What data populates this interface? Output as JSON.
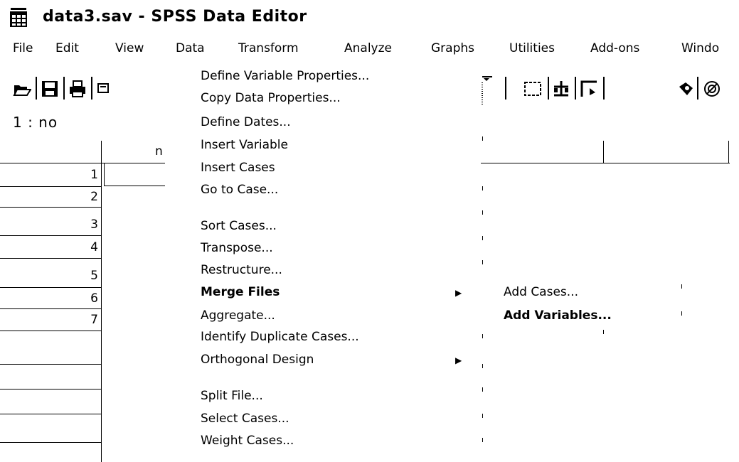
{
  "window": {
    "title": "data3.sav - SPSS Data Editor",
    "app_icon": "spss-icon"
  },
  "menubar": [
    "File",
    "Edit",
    "View",
    "Data",
    "Transform",
    "Analyze",
    "Graphs",
    "Utilities",
    "Add-ons",
    "Windo"
  ],
  "toolbar": {
    "left_icons": [
      "open-folder-icon",
      "save-disk-icon",
      "print-icon",
      "dialog-recall-icon"
    ],
    "right_icons": [
      "variables-icon",
      "split-file-icon",
      "weight-cases-icon",
      "select-cases-icon",
      "value-labels-icon",
      "use-sets-icon"
    ]
  },
  "cell_ref": "1 : no",
  "grid": {
    "column_header": "n",
    "rows": [
      "1",
      "2",
      "3",
      "4",
      "5",
      "6",
      "7",
      "",
      "",
      "",
      "",
      ""
    ]
  },
  "data_menu": {
    "items": [
      {
        "label": "Define Variable Properties...",
        "bold": false,
        "submenu": false
      },
      {
        "label": "Copy Data Properties...",
        "bold": false,
        "submenu": false
      },
      {
        "label": "Define Dates...",
        "bold": false,
        "submenu": false
      },
      {
        "label": "Insert Variable",
        "bold": false,
        "submenu": false
      },
      {
        "label": "Insert Cases",
        "bold": false,
        "submenu": false
      },
      {
        "label": "Go to Case...",
        "bold": false,
        "submenu": false
      },
      {
        "label": "Sort Cases...",
        "bold": false,
        "submenu": false
      },
      {
        "label": "Transpose...",
        "bold": false,
        "submenu": false
      },
      {
        "label": "Restructure...",
        "bold": false,
        "submenu": false
      },
      {
        "label": "Merge Files",
        "bold": true,
        "submenu": true
      },
      {
        "label": "Aggregate...",
        "bold": false,
        "submenu": false
      },
      {
        "label": "Identify Duplicate Cases...",
        "bold": false,
        "submenu": false
      },
      {
        "label": "Orthogonal Design",
        "bold": false,
        "submenu": true
      },
      {
        "label": "Split File...",
        "bold": false,
        "submenu": false
      },
      {
        "label": "Select Cases...",
        "bold": false,
        "submenu": false
      },
      {
        "label": "Weight Cases...",
        "bold": false,
        "submenu": false
      }
    ]
  },
  "merge_submenu": {
    "items": [
      {
        "label": "Add Cases...",
        "bold": false
      },
      {
        "label": "Add Variables...",
        "bold": true
      }
    ]
  }
}
